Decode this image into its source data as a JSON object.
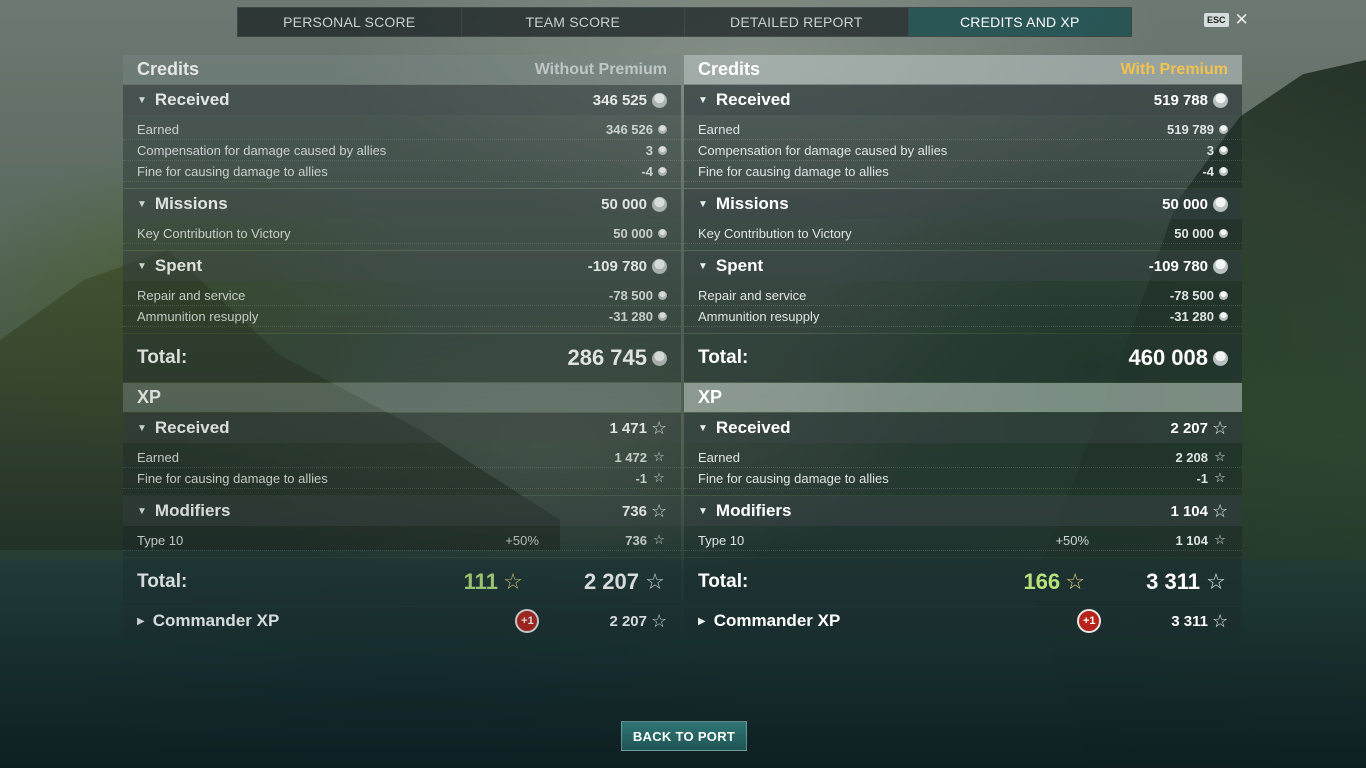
{
  "tabs": [
    {
      "label": "PERSONAL SCORE",
      "active": false
    },
    {
      "label": "TEAM SCORE",
      "active": false
    },
    {
      "label": "DETAILED REPORT",
      "active": false
    },
    {
      "label": "CREDITS AND XP",
      "active": true
    }
  ],
  "esc_label": "ESC",
  "back_button": "BACK TO PORT",
  "colors": {
    "premium_gold": "#f1c34e",
    "premium_xp_green": "#b6e27c",
    "active_tab": "#286060",
    "badge_red": "#b8231b"
  },
  "icons": {
    "coin": "credit-coin-icon",
    "star": "xp-star-icon",
    "collapse": "triangle-down-icon",
    "expand": "triangle-right-icon",
    "close": "close-icon"
  },
  "left": {
    "credits": {
      "title": "Credits",
      "mode": "Without Premium",
      "received": {
        "label": "Received",
        "value": "346 525",
        "rows": [
          {
            "label": "Earned",
            "value": "346 526"
          },
          {
            "label": "Compensation for damage caused by allies",
            "value": "3"
          },
          {
            "label": "Fine for causing damage to allies",
            "value": "-4"
          }
        ]
      },
      "missions": {
        "label": "Missions",
        "value": "50 000",
        "rows": [
          {
            "label": "Key Contribution to Victory",
            "value": "50 000"
          }
        ]
      },
      "spent": {
        "label": "Spent",
        "value": "-109 780",
        "rows": [
          {
            "label": "Repair and service",
            "value": "-78 500"
          },
          {
            "label": "Ammunition resupply",
            "value": "-31 280"
          }
        ]
      },
      "total_label": "Total:",
      "total": "286 745"
    },
    "xp": {
      "title": "XP",
      "received": {
        "label": "Received",
        "value": "1 471",
        "rows": [
          {
            "label": "Earned",
            "value": "1 472"
          },
          {
            "label": "Fine for causing damage to allies",
            "value": "-1"
          }
        ]
      },
      "modifiers": {
        "label": "Modifiers",
        "value": "736",
        "rows": [
          {
            "label": "Type 10",
            "pct": "+50%",
            "value": "736"
          }
        ]
      },
      "total_label": "Total:",
      "premium_bonus": "111",
      "total": "2 207",
      "commander_label": "Commander XP",
      "commander_badge": "+1",
      "commander_value": "2 207"
    }
  },
  "right": {
    "credits": {
      "title": "Credits",
      "mode": "With Premium",
      "received": {
        "label": "Received",
        "value": "519 788",
        "rows": [
          {
            "label": "Earned",
            "value": "519 789"
          },
          {
            "label": "Compensation for damage caused by allies",
            "value": "3"
          },
          {
            "label": "Fine for causing damage to allies",
            "value": "-4"
          }
        ]
      },
      "missions": {
        "label": "Missions",
        "value": "50 000",
        "rows": [
          {
            "label": "Key Contribution to Victory",
            "value": "50 000"
          }
        ]
      },
      "spent": {
        "label": "Spent",
        "value": "-109 780",
        "rows": [
          {
            "label": "Repair and service",
            "value": "-78 500"
          },
          {
            "label": "Ammunition resupply",
            "value": "-31 280"
          }
        ]
      },
      "total_label": "Total:",
      "total": "460 008"
    },
    "xp": {
      "title": "XP",
      "received": {
        "label": "Received",
        "value": "2 207",
        "rows": [
          {
            "label": "Earned",
            "value": "2 208"
          },
          {
            "label": "Fine for causing damage to allies",
            "value": "-1"
          }
        ]
      },
      "modifiers": {
        "label": "Modifiers",
        "value": "1 104",
        "rows": [
          {
            "label": "Type 10",
            "pct": "+50%",
            "value": "1 104"
          }
        ]
      },
      "total_label": "Total:",
      "premium_bonus": "166",
      "total": "3 311",
      "commander_label": "Commander XP",
      "commander_badge": "+1",
      "commander_value": "3 311"
    }
  }
}
